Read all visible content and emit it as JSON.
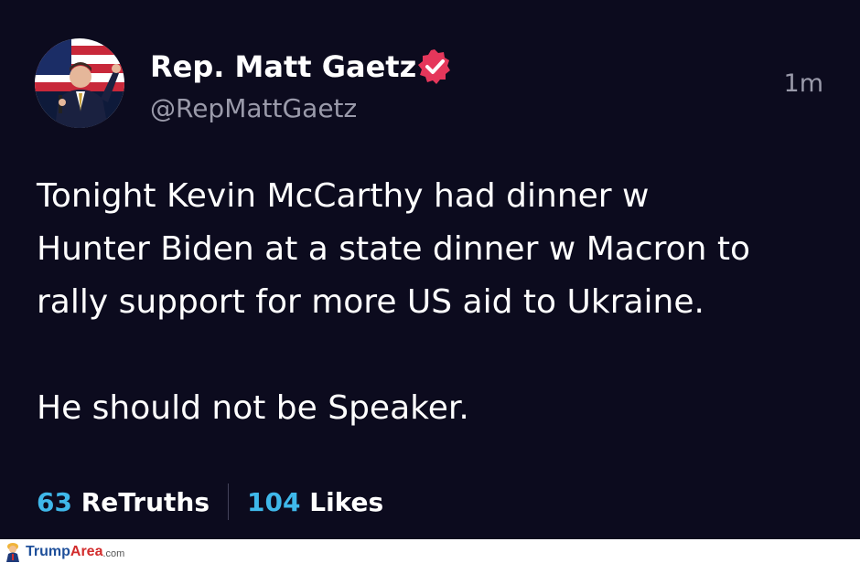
{
  "author": {
    "display_name": "Rep. Matt Gaetz",
    "handle": "@RepMattGaetz",
    "timestamp": "1m",
    "verified_icon": "verified-badge-icon",
    "verified_color": "#e5375b"
  },
  "post": {
    "lines_1": [
      "Tonight Kevin McCarthy had dinner w",
      "Hunter Biden at a state dinner w Macron to",
      "rally support for more US aid to Ukraine."
    ],
    "line_2": "He should not be Speaker."
  },
  "stats": {
    "retruths_count": "63",
    "retruths_label": "ReTruths",
    "likes_count": "104",
    "likes_label": "Likes",
    "accent_color": "#3fb8ea"
  },
  "watermark": {
    "part_a": "Trump",
    "part_b": "Area",
    "part_c": ".com"
  }
}
